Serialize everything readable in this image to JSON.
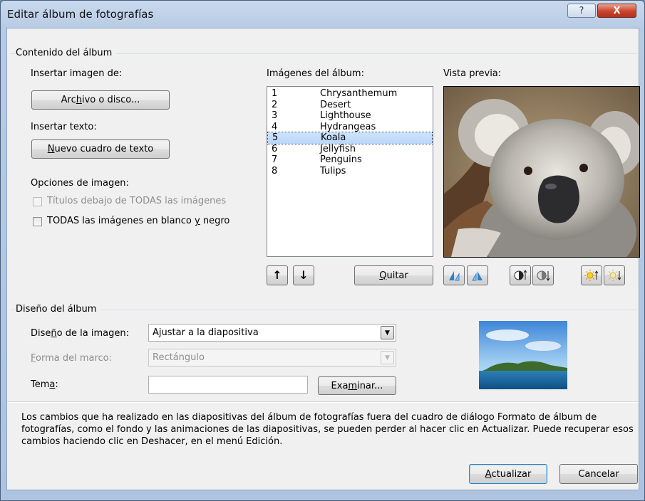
{
  "window": {
    "title": "Editar álbum de fotografías",
    "help_glyph": "?",
    "close_glyph": "X"
  },
  "content_group": {
    "label": "Contenido del álbum",
    "insert_image_label": "Insertar imagen de:",
    "file_button": {
      "pre": "Arc",
      "accel": "h",
      "post": "ivo o disco..."
    },
    "insert_text_label": "Insertar texto:",
    "new_textbox_button": {
      "accel": "N",
      "post": "uevo cuadro de texto"
    },
    "image_options_label": "Opciones de imagen:",
    "captions_checkbox": {
      "label": "Títulos debajo de TODAS las imágenes",
      "checked": false,
      "enabled": false
    },
    "bw_checkbox": {
      "pre": "TODAS las imágenes en blanco ",
      "accel": "y",
      "post": " negro",
      "checked": false,
      "enabled": true
    }
  },
  "album_images": {
    "label": "Imágenes del álbum:",
    "items": [
      {
        "num": "1",
        "name": "Chrysanthemum"
      },
      {
        "num": "2",
        "name": "Desert"
      },
      {
        "num": "3",
        "name": "Lighthouse"
      },
      {
        "num": "4",
        "name": "Hydrangeas"
      },
      {
        "num": "5",
        "name": "Koala"
      },
      {
        "num": "6",
        "name": "Jellyfish"
      },
      {
        "num": "7",
        "name": "Penguins"
      },
      {
        "num": "8",
        "name": "Tulips"
      }
    ],
    "selected_index": 4,
    "move_up_glyph": "↑",
    "move_down_glyph": "↓",
    "remove_button": {
      "accel": "Q",
      "post": "uitar"
    }
  },
  "preview": {
    "label": "Vista previa:",
    "tool_icons": [
      "rotate-left-icon",
      "rotate-right-icon",
      "contrast-increase-icon",
      "contrast-decrease-icon",
      "brightness-increase-icon",
      "brightness-decrease-icon"
    ]
  },
  "design_group": {
    "label": "Diseño del álbum",
    "layout_label": {
      "pre": "Dise",
      "accel": "ñ",
      "post": "o de la imagen:"
    },
    "layout_value": "Ajustar a la diapositiva",
    "frame_label": {
      "accel": "F",
      "post": "orma del marco:"
    },
    "frame_value": "Rectángulo",
    "theme_label": {
      "pre": "Tem",
      "accel": "a",
      "post": ":"
    },
    "theme_value": "",
    "browse_button": {
      "pre": "Exa",
      "accel": "m",
      "post": "inar..."
    }
  },
  "notice": "Los cambios que ha realizado en las diapositivas del álbum de fotografías fuera del cuadro de diálogo Formato de álbum de fotografías, como el fondo y las animaciones de las diapositivas, se pueden perder al hacer clic en Actualizar. Puede recuperar esos cambios haciendo clic en Deshacer, en el menú Edición.",
  "footer": {
    "update_button": {
      "accel": "A",
      "post": "ctualizar"
    },
    "cancel_button": "Cancelar"
  },
  "colors": {
    "selection": "#b9d7f8",
    "titlebar": "#c9d9ee",
    "close": "#c7452d"
  }
}
